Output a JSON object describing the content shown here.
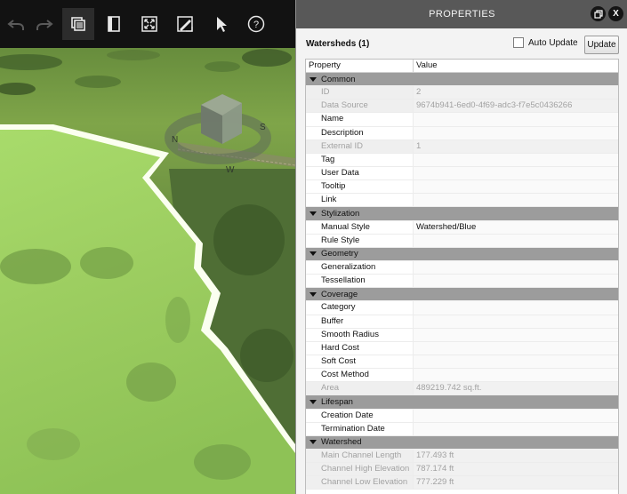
{
  "toolbar": {
    "buttons": [
      {
        "name": "undo",
        "icon": "undo-icon",
        "enabled": false
      },
      {
        "name": "redo",
        "icon": "redo-icon",
        "enabled": false
      },
      {
        "name": "copy",
        "icon": "copy-layers-icon",
        "enabled": true
      },
      {
        "name": "book",
        "icon": "book-icon",
        "enabled": true
      },
      {
        "name": "zoom-extent",
        "icon": "zoom-extent-icon",
        "enabled": true
      },
      {
        "name": "edit-terrain",
        "icon": "edit-terrain-icon",
        "enabled": true
      },
      {
        "name": "select",
        "icon": "cursor-icon",
        "enabled": true
      },
      {
        "name": "help",
        "icon": "help-icon",
        "enabled": true
      }
    ]
  },
  "viewport": {
    "navigation_cube": {
      "compass_labels": [
        "N",
        "S",
        "W"
      ]
    },
    "colors": {
      "terrain": "#6f9242",
      "watershed_fill": "#a7d86b",
      "watershed_edge": "#fbfff0"
    }
  },
  "panel": {
    "title": "PROPERTIES",
    "selection_title": "Watersheds (1)",
    "auto_update_label": "Auto Update",
    "auto_update_checked": false,
    "update_label": "Update",
    "columns": [
      "Property",
      "Value"
    ],
    "categories": [
      {
        "name": "Common",
        "rows": [
          {
            "label": "ID",
            "value": "2",
            "readonly": true
          },
          {
            "label": "Data Source",
            "value": "9674b941-6ed0-4f69-adc3-f7e5c0436266",
            "readonly": true
          },
          {
            "label": "Name",
            "value": "",
            "readonly": false
          },
          {
            "label": "Description",
            "value": "",
            "readonly": false
          },
          {
            "label": "External ID",
            "value": "1",
            "readonly": true
          },
          {
            "label": "Tag",
            "value": "",
            "readonly": false
          },
          {
            "label": "User Data",
            "value": "",
            "readonly": false
          },
          {
            "label": "Tooltip",
            "value": "",
            "readonly": false
          },
          {
            "label": "Link",
            "value": "",
            "readonly": false
          }
        ]
      },
      {
        "name": "Stylization",
        "rows": [
          {
            "label": "Manual Style",
            "value": "Watershed/Blue",
            "readonly": false
          },
          {
            "label": "Rule Style",
            "value": "",
            "readonly": false
          }
        ]
      },
      {
        "name": "Geometry",
        "rows": [
          {
            "label": "Generalization",
            "value": "",
            "readonly": false
          },
          {
            "label": "Tessellation",
            "value": "",
            "readonly": false
          }
        ]
      },
      {
        "name": "Coverage",
        "rows": [
          {
            "label": "Category",
            "value": "",
            "readonly": false
          },
          {
            "label": "Buffer",
            "value": "",
            "readonly": false
          },
          {
            "label": "Smooth Radius",
            "value": "",
            "readonly": false
          },
          {
            "label": "Hard Cost",
            "value": "",
            "readonly": false
          },
          {
            "label": "Soft Cost",
            "value": "",
            "readonly": false
          },
          {
            "label": "Cost Method",
            "value": "",
            "readonly": false
          },
          {
            "label": "Area",
            "value": "489219.742 sq.ft.",
            "readonly": true
          }
        ]
      },
      {
        "name": "Lifespan",
        "rows": [
          {
            "label": "Creation Date",
            "value": "",
            "readonly": false
          },
          {
            "label": "Termination Date",
            "value": "",
            "readonly": false
          }
        ]
      },
      {
        "name": "Watershed",
        "rows": [
          {
            "label": "Main Channel Length",
            "value": "177.493 ft",
            "readonly": true
          },
          {
            "label": "Channel High Elevation",
            "value": "787.174 ft",
            "readonly": true
          },
          {
            "label": "Channel Low Elevation",
            "value": "777.229 ft",
            "readonly": true
          }
        ]
      }
    ]
  }
}
